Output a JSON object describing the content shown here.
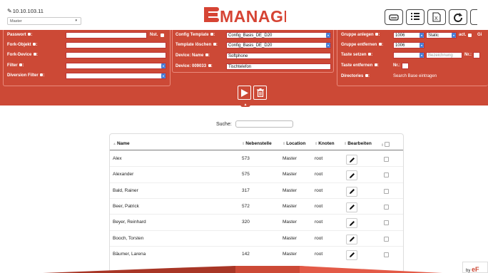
{
  "header": {
    "ip": "10.10.103.11",
    "server": "Master",
    "logo": "eMANAGER"
  },
  "toolbar": [
    "printer-icon",
    "list-icon",
    "excel-icon",
    "refresh-icon",
    "more-icon"
  ],
  "left": {
    "passwort": "Passwort",
    "nst": "Nst.",
    "fork_objekt": "Fork-Objekt",
    "fork_device": "Fork-Device",
    "filter": "Filter",
    "diversion_filter": "Diversion Filter"
  },
  "middle": {
    "config_template_label": "Config Template",
    "config_template_value": "Config_Basis_DE_D20",
    "template_loeschen_label": "Template löschen",
    "template_loeschen_value": "Config_Basis_DE_D20",
    "device_name_label": "Device: Name",
    "device_name_value": "Softphone",
    "device_num_label": "Device: 009033",
    "device_num_value": "Tischtelefon"
  },
  "right": {
    "gruppe_anlegen_label": "Gruppe anlegen",
    "gruppe_anlegen_value": "1006",
    "static_value": "Static",
    "act_label": "act.",
    "gi_label": "Gi",
    "gruppe_entfernen_label": "Gruppe entfernen",
    "gruppe_entfernen_value": "1006",
    "taste_setzen_label": "Taste setzen",
    "bezeichnung_placeholder": "Bezeichnung",
    "nr_label": "Nr.:",
    "taste_entfernen_label": "Taste entfernen",
    "nr2_label": "Nr.:",
    "directories_label": "Directories",
    "search_base": "Search Base eintragen"
  },
  "search": {
    "label": "Suche:",
    "value": ""
  },
  "table": {
    "headers": [
      "Name",
      "Nebenstelle",
      "Location",
      "Knoten",
      "Bearbeiten"
    ],
    "rows": [
      {
        "name": "Alex",
        "ext": "573",
        "loc": "Master",
        "node": "root"
      },
      {
        "name": "Alexander",
        "ext": "575",
        "loc": "Master",
        "node": "root"
      },
      {
        "name": "Bald, Rainer",
        "ext": "317",
        "loc": "Master",
        "node": "root"
      },
      {
        "name": "Beer, Patrick",
        "ext": "572",
        "loc": "Master",
        "node": "root"
      },
      {
        "name": "Beyer, Reinhard",
        "ext": "320",
        "loc": "Master",
        "node": "root"
      },
      {
        "name": "Booch, Torsten",
        "ext": "",
        "loc": "Master",
        "node": "root"
      },
      {
        "name": "Bäumer, Larena",
        "ext": "142",
        "loc": "Master",
        "node": "root"
      }
    ]
  },
  "brand": {
    "by": "by",
    "mark": "eF"
  },
  "colors": {
    "panel": "#cc4936",
    "accent": "#4a7fd6"
  }
}
